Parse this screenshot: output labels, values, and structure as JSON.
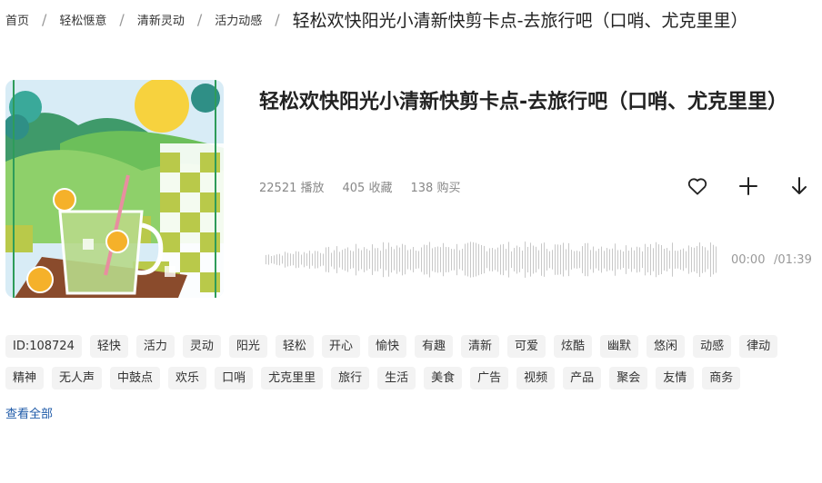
{
  "breadcrumb": {
    "items": [
      "首页",
      "轻松惬意",
      "清新灵动",
      "活力动感"
    ],
    "separator": "/",
    "current": "轻松欢快阳光小清新快剪卡点-去旅行吧（口哨、尤克里里）"
  },
  "track": {
    "title": "轻松欢快阳光小清新快剪卡点-去旅行吧（口哨、尤克里里）",
    "stats": {
      "plays": "22521",
      "plays_label": "播放",
      "favorites": "405",
      "favorites_label": "收藏",
      "purchases": "138",
      "purchases_label": "购买"
    }
  },
  "actions": {
    "like_icon": "heart-icon",
    "add_icon": "plus-icon",
    "download_icon": "download-arrow-icon"
  },
  "player": {
    "current_time": "00:00",
    "total_time": "/01:39",
    "waveform_color": "#c8c8c8"
  },
  "tags": [
    "ID:108724",
    "轻快",
    "活力",
    "灵动",
    "阳光",
    "轻松",
    "开心",
    "愉快",
    "有趣",
    "清新",
    "可爱",
    "炫酷",
    "幽默",
    "悠闲",
    "动感",
    "律动",
    "精神",
    "无人声",
    "中鼓点",
    "欢乐",
    "口哨",
    "尤克里里",
    "旅行",
    "生活",
    "美食",
    "广告",
    "视频",
    "产品",
    "聚会",
    "友情",
    "商务"
  ],
  "view_all": "查看全部",
  "colors": {
    "link": "#1e5aa8",
    "tag_bg": "#f3f3f3"
  }
}
